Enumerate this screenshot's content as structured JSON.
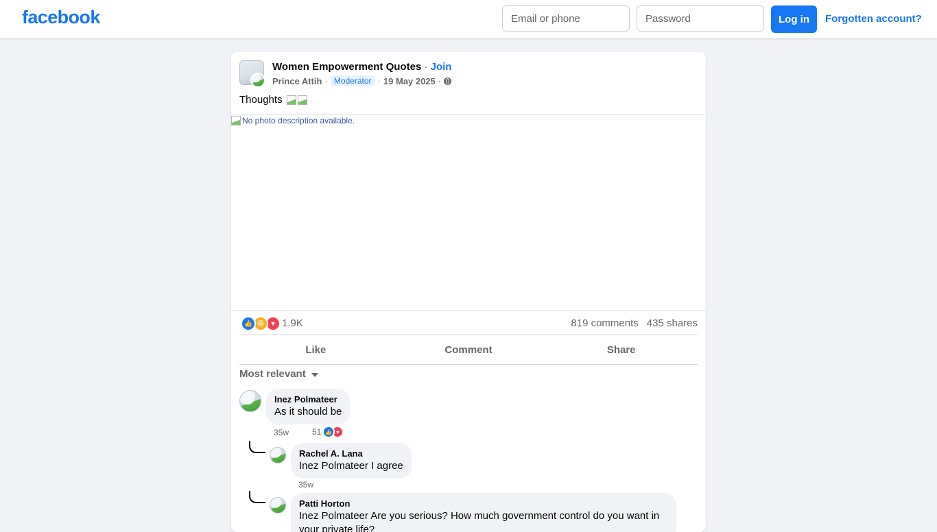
{
  "header": {
    "logo": "facebook",
    "email_placeholder": "Email or phone",
    "password_placeholder": "Password",
    "login_label": "Log in",
    "forgot_label": "Forgotten account?"
  },
  "post": {
    "group_name": "Women Empowerment Quotes",
    "join_label": "Join",
    "author": "Prince Attih",
    "role_badge": "Moderator",
    "date": "19 May 2025",
    "text": "Thoughts",
    "image_alt": "No photo description available.",
    "reaction_count": "1.9K",
    "reactions": [
      "like",
      "haha",
      "love"
    ],
    "comments_count": "819 comments",
    "shares_count": "435 shares"
  },
  "actions": {
    "like": "Like",
    "comment": "Comment",
    "share": "Share"
  },
  "comments_section": {
    "sort_label": "Most relevant"
  },
  "comments": [
    {
      "author": "Inez Polmateer",
      "text": "As it should be",
      "time": "35w",
      "reaction_count": "51"
    },
    {
      "author": "Rachel A. Lana",
      "text": "Inez Polmateer I agree",
      "time": "35w"
    },
    {
      "author": "Patti Horton",
      "text": "Inez Polmateer Are you serious? How much government control do you want in your private life?"
    }
  ],
  "colors": {
    "brand": "#1877f2",
    "background": "#f0f2f5",
    "secondary_text": "#65676b"
  }
}
